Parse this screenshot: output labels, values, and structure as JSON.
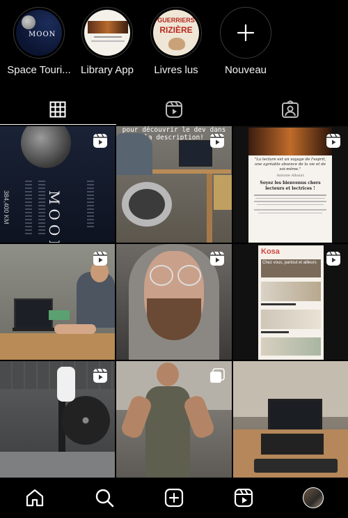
{
  "highlights": [
    {
      "label": "Space Touri...",
      "thumb_text": "MOON"
    },
    {
      "label": "Library App"
    },
    {
      "label": "Livres lus",
      "thumb_text_1": "GUERRIERS",
      "thumb_text_2": "RIZIÈRE"
    },
    {
      "label": "Nouveau"
    }
  ],
  "tabs": [
    {
      "name": "posts",
      "icon": "grid-icon",
      "active": true
    },
    {
      "name": "reels",
      "icon": "reels-icon",
      "active": false
    },
    {
      "name": "tagged",
      "icon": "tagged-person-icon",
      "active": false
    }
  ],
  "grid": {
    "tile1": {
      "title": "MOON",
      "stat": "384,400 KM"
    },
    "tile2": {
      "caption_1": "pour découvrir le dev dans",
      "caption_2": "la description!"
    },
    "tile3": {
      "quote": "\"La lecture est un voyage de l'esprit, une agréable absence de la vie et de soi-même.\"",
      "author": "Antoine Albalat",
      "heading": "Soyez les bienvenus chers lecteurs et lectrices !"
    },
    "tile6": {
      "brand": "Kosa",
      "headline": "Chez vous, partout et ailleurs"
    }
  },
  "bottom_nav": [
    {
      "name": "home",
      "icon": "home-icon"
    },
    {
      "name": "search",
      "icon": "search-icon"
    },
    {
      "name": "create",
      "icon": "plus-square-icon"
    },
    {
      "name": "reels",
      "icon": "reels-icon"
    },
    {
      "name": "profile",
      "icon": "profile-avatar"
    }
  ]
}
